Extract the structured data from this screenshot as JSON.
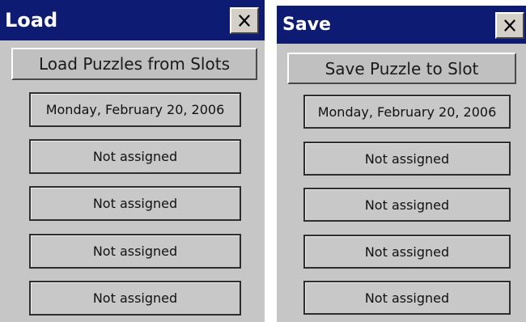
{
  "load_dialog": {
    "title": "Load",
    "header_button": "Load Puzzles from Slots",
    "slots": [
      "Monday, February 20, 2006",
      "Not assigned",
      "Not assigned",
      "Not assigned",
      "Not assigned"
    ]
  },
  "save_dialog": {
    "title": "Save",
    "header_button": "Save Puzzle to Slot",
    "slots": [
      "Monday, February 20, 2006",
      "Not assigned",
      "Not assigned",
      "Not assigned",
      "Not assigned"
    ]
  },
  "colors": {
    "titlebar": "#0d1c72",
    "dialog_bg": "#c6c6c6",
    "title_text": "#ffffff"
  },
  "icons": {
    "close": "close-icon"
  }
}
